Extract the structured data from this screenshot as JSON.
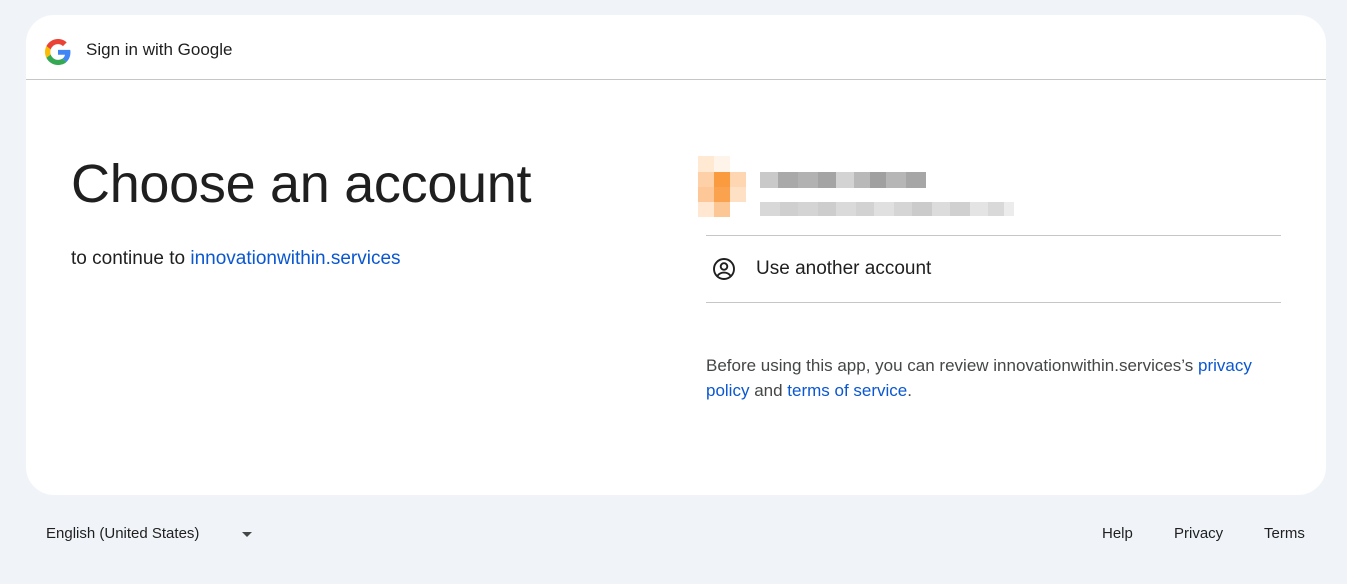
{
  "header": {
    "title": "Sign in with Google",
    "logo_icon": "google-g-icon"
  },
  "main": {
    "headline": "Choose an account",
    "subhead_prefix": "to continue to ",
    "subhead_link": "innovationwithin.services"
  },
  "accounts": {
    "redacted_account": {
      "note_icon": "avatar-icon"
    },
    "use_another_label": "Use another account",
    "use_another_icon": "person-circle-icon"
  },
  "disclaimer": {
    "prefix": "Before using this app, you can review innovationwithin.services’s ",
    "privacy_link": "privacy policy",
    "middle": " and ",
    "terms_link": "terms of service",
    "suffix": "."
  },
  "footer": {
    "language": "English (United States)",
    "help": "Help",
    "privacy": "Privacy",
    "terms": "Terms"
  },
  "colors": {
    "link": "#0b57d0",
    "page_bg": "#f0f4f9",
    "card_bg": "#ffffff",
    "divider": "#c4c7c5"
  }
}
